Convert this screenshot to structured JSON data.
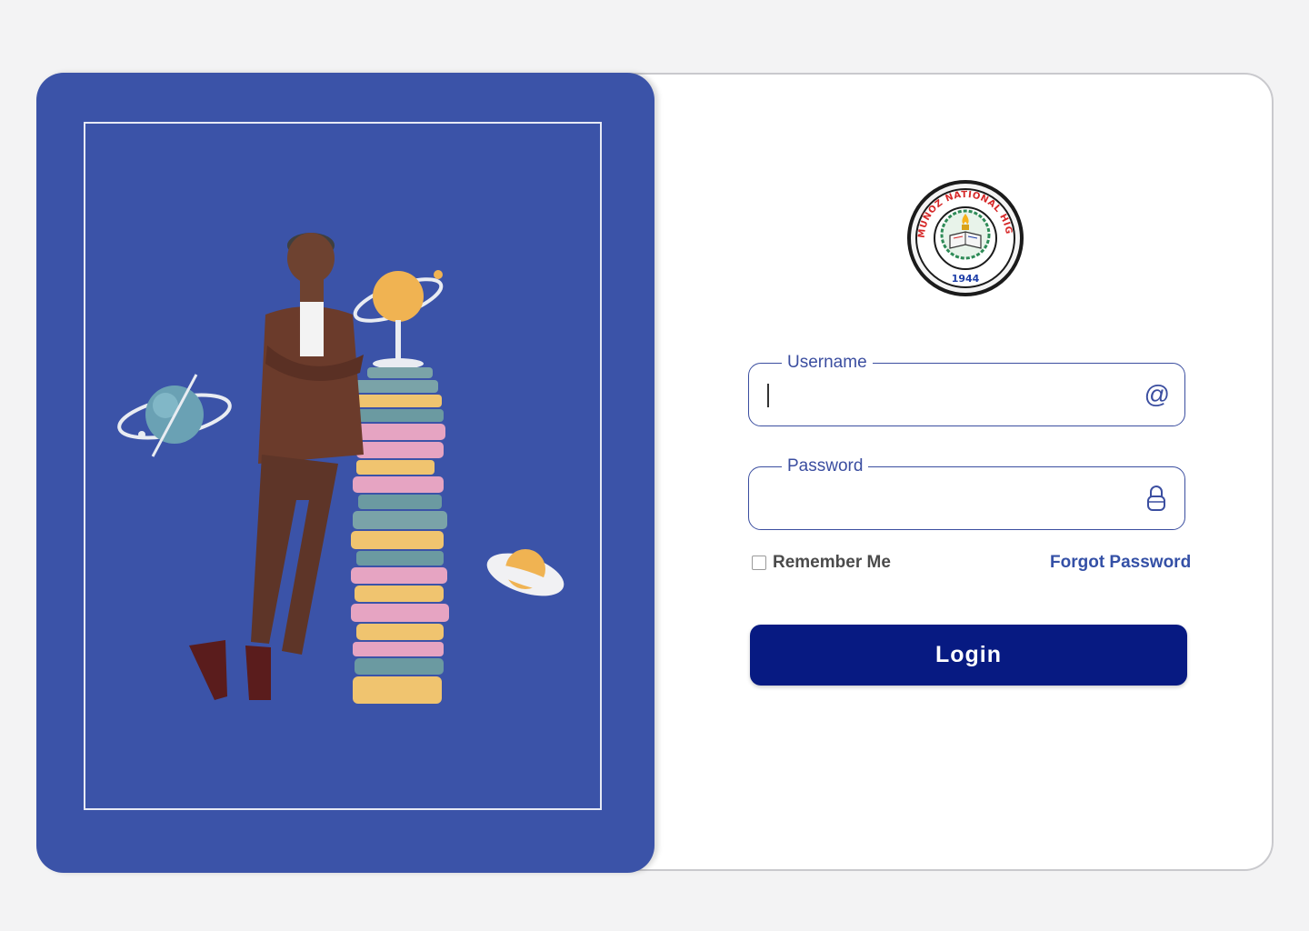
{
  "login_form": {
    "username_label": "Username",
    "username_value": "",
    "password_label": "Password",
    "password_value": "",
    "remember_label": "Remember Me",
    "remember_checked": false,
    "forgot_label": "Forgot Password",
    "login_label": "Login"
  },
  "logo": {
    "ring_text": "MUÑOZ NATIONAL HIGH SCHOOL",
    "year": "1944"
  },
  "icons": {
    "username_icon": "at-icon",
    "password_icon": "lock-icon"
  },
  "colors": {
    "panel_blue": "#3b53a8",
    "button_navy": "#071a82",
    "link_blue": "#3450a6",
    "field_border": "#3b4ea0"
  }
}
